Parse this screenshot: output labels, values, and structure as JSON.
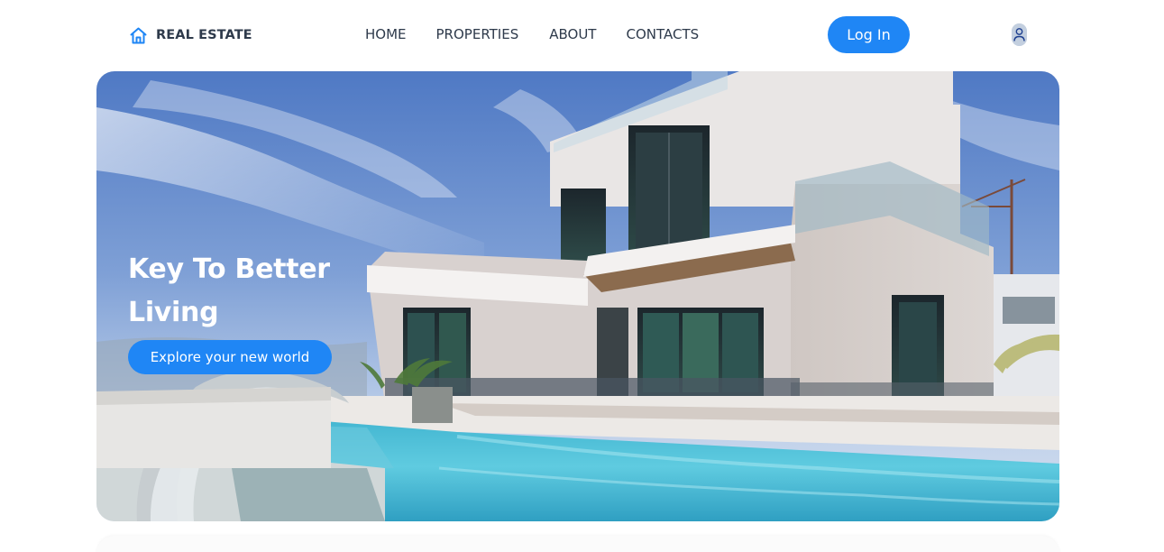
{
  "brand": {
    "name": "REAL ESTATE",
    "icon": "house-outline-icon",
    "accent_color": "#1f86f5"
  },
  "nav": {
    "items": [
      {
        "label": "HOME"
      },
      {
        "label": "PROPERTIES"
      },
      {
        "label": "ABOUT"
      },
      {
        "label": "CONTACTS"
      }
    ]
  },
  "header": {
    "login_label": "Log In",
    "avatar_icon": "user-avatar-icon"
  },
  "hero": {
    "title": "Key To Better Living",
    "cta_label": "Explore your new world",
    "image": "modern-villa-with-pool-photo"
  },
  "colors": {
    "primary": "#1f86f5",
    "text_dark": "#2e3a4b",
    "white": "#ffffff"
  }
}
